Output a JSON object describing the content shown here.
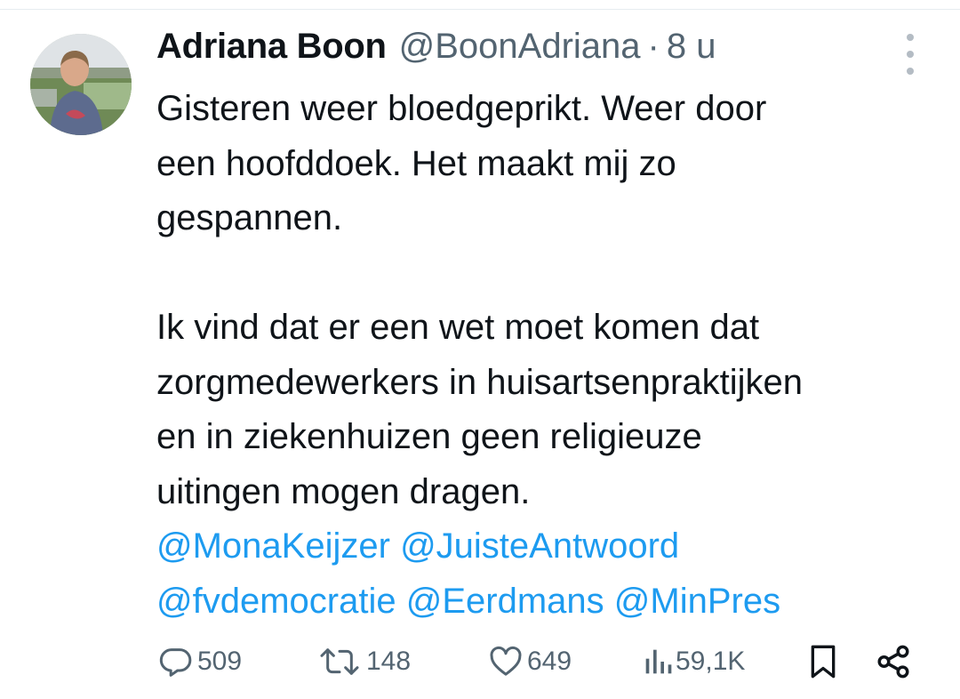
{
  "tweet": {
    "author_name": "Adriana Boon",
    "author_handle": "@BoonAdriana",
    "separator": "·",
    "time": "8 u",
    "text_lines_1": [
      "Gisteren weer bloedgeprikt. Weer door",
      "een hoofddoek. Het maakt mij zo",
      "gespannen."
    ],
    "text_lines_2": [
      "Ik vind dat er een wet moet komen dat",
      "zorgmedewerkers in huisartsenpraktijken",
      "en in ziekenhuizen geen religieuze",
      "uitingen mogen dragen."
    ],
    "mentions": [
      "@MonaKeijzer",
      "@JuisteAntwoord",
      "@fvdemocratie",
      "@Eerdmans",
      "@MinPres"
    ]
  },
  "actions": {
    "replies": "509",
    "retweets": "148",
    "likes": "649",
    "views": "59,1K"
  },
  "colors": {
    "text": "#0f1419",
    "secondary": "#536471",
    "link": "#1d9bf0"
  },
  "icons": [
    "more-icon",
    "reply-icon",
    "retweet-icon",
    "like-icon",
    "views-icon",
    "bookmark-icon",
    "share-icon"
  ]
}
